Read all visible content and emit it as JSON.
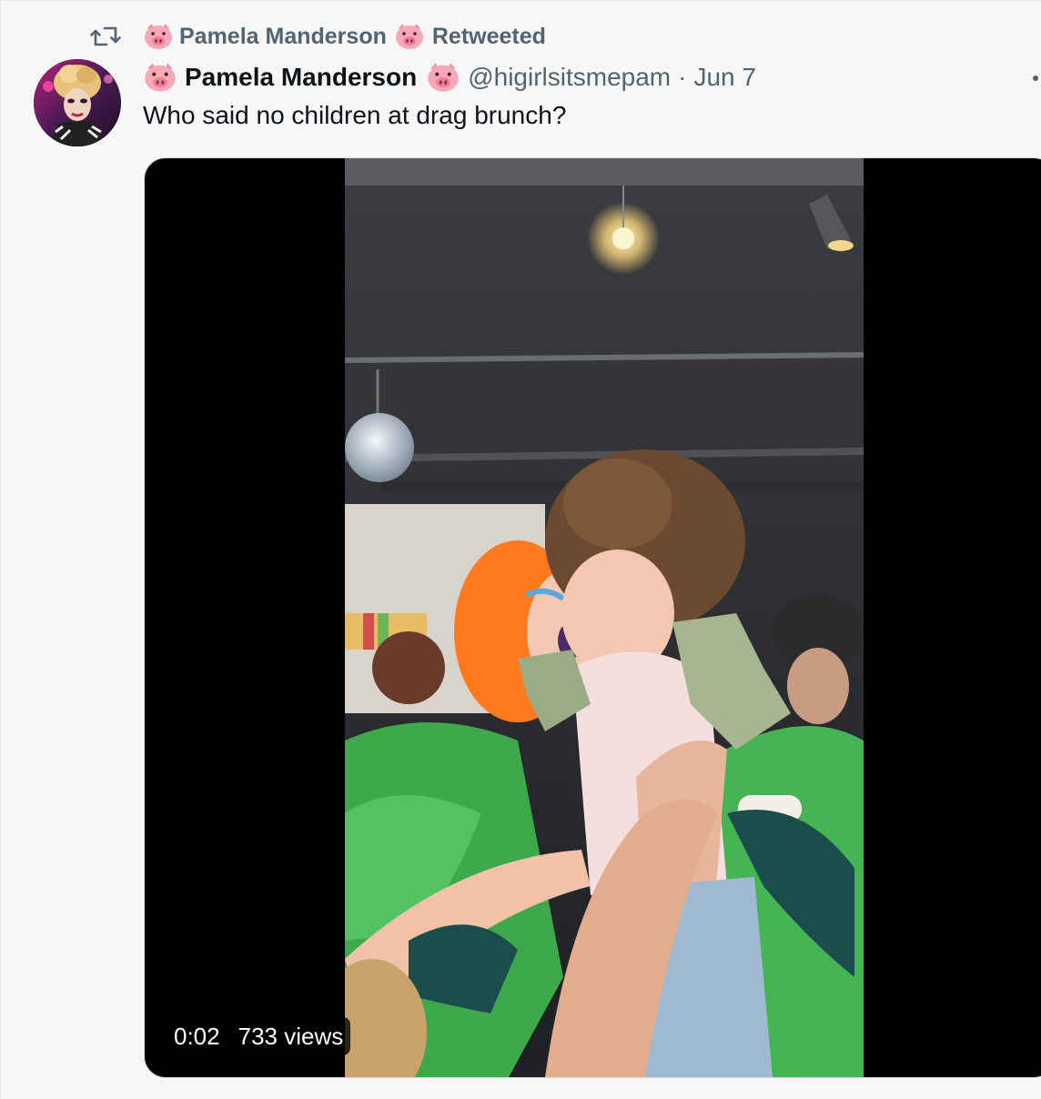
{
  "retweet": {
    "icon": "retweet-icon",
    "name": "Pamela Manderson",
    "label": "Retweeted"
  },
  "tweet": {
    "author": {
      "display_name": "Pamela Manderson",
      "handle": "@higirlsitsmepam",
      "avatar": "drag-queen-avatar"
    },
    "separator": "·",
    "date": "Jun 7",
    "text": "Who said no children at drag brunch?",
    "media": {
      "type": "video",
      "time": "0:02",
      "views": "733 views"
    }
  },
  "colors": {
    "secondary_text": "#536471",
    "primary_text": "#0f1419",
    "background": "#f7f7f7",
    "pig_emoji": "#f7a8b8"
  }
}
